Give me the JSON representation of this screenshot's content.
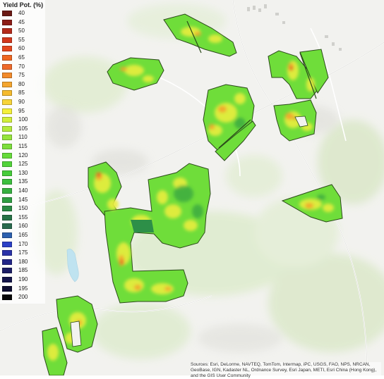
{
  "legend": {
    "title": "Yield Pot. (%)",
    "classes": [
      {
        "label": "40",
        "color": "#6b1a14"
      },
      {
        "label": "45",
        "color": "#8c1c16"
      },
      {
        "label": "50",
        "color": "#b42a1a"
      },
      {
        "label": "55",
        "color": "#d2371c"
      },
      {
        "label": "60",
        "color": "#e4471e"
      },
      {
        "label": "65",
        "color": "#ef6720"
      },
      {
        "label": "70",
        "color": "#ef6a2a"
      },
      {
        "label": "75",
        "color": "#f28a2a"
      },
      {
        "label": "80",
        "color": "#f4a52e"
      },
      {
        "label": "85",
        "color": "#f5bb2e"
      },
      {
        "label": "90",
        "color": "#f7d43a"
      },
      {
        "label": "95",
        "color": "#f4f03a"
      },
      {
        "label": "100",
        "color": "#d2ef3a"
      },
      {
        "label": "105",
        "color": "#b4ea3c"
      },
      {
        "label": "110",
        "color": "#96e53c"
      },
      {
        "label": "115",
        "color": "#7ddf3c"
      },
      {
        "label": "120",
        "color": "#66db3a"
      },
      {
        "label": "125",
        "color": "#52d43a"
      },
      {
        "label": "130",
        "color": "#46cc3a"
      },
      {
        "label": "135",
        "color": "#3cbf3e"
      },
      {
        "label": "140",
        "color": "#36b040"
      },
      {
        "label": "145",
        "color": "#2f9e42"
      },
      {
        "label": "150",
        "color": "#2a8a44"
      },
      {
        "label": "155",
        "color": "#277346"
      },
      {
        "label": "160",
        "color": "#2a6b4e"
      },
      {
        "label": "165",
        "color": "#2c5fae"
      },
      {
        "label": "170",
        "color": "#2b3fc6"
      },
      {
        "label": "175",
        "color": "#2a32a8"
      },
      {
        "label": "180",
        "color": "#222688"
      },
      {
        "label": "185",
        "color": "#1c1e66"
      },
      {
        "label": "190",
        "color": "#15164a"
      },
      {
        "label": "195",
        "color": "#0f0f30"
      },
      {
        "label": "200",
        "color": "#080808"
      }
    ]
  },
  "attribution": "Sources: Esri, DeLorme, NAVTEQ, TomTom, Intermap, iPC, USGS, FAO, NPS, NRCAN, GeoBase, IGN, Kadaster NL, Ordnance Survey, Esri Japan, METI, Esri China (Hong Kong), and the GIS User Community"
}
